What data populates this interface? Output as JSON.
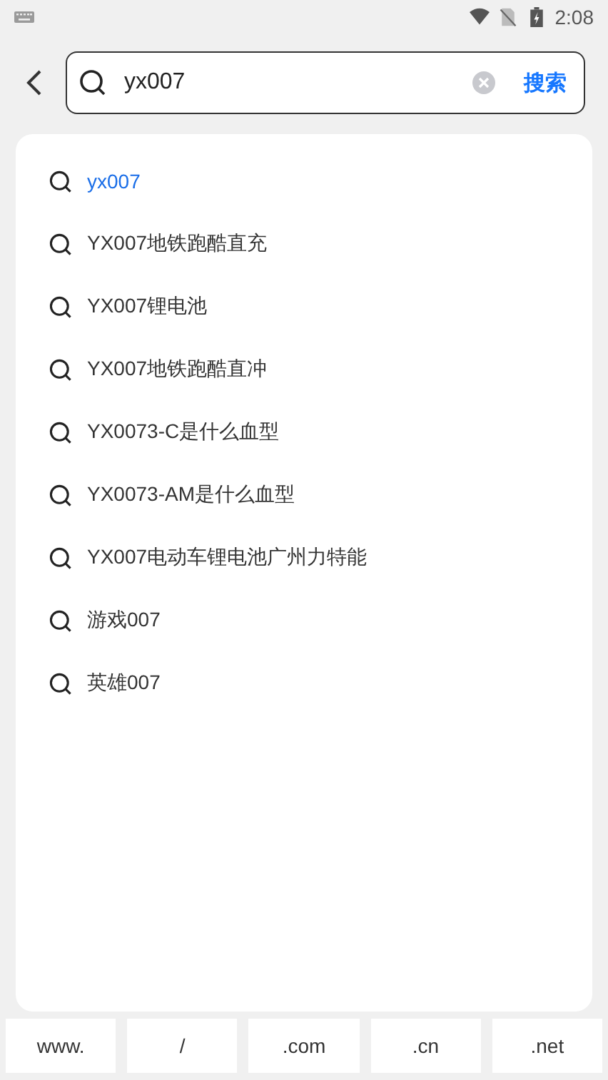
{
  "status_bar": {
    "time": "2:08"
  },
  "search": {
    "value": "yx007",
    "button": "搜索"
  },
  "suggestions": [
    {
      "text": "yx007",
      "highlighted": true
    },
    {
      "text": "YX007地铁跑酷直充",
      "highlighted": false
    },
    {
      "text": "YX007锂电池",
      "highlighted": false
    },
    {
      "text": "YX007地铁跑酷直冲",
      "highlighted": false
    },
    {
      "text": "YX0073-C是什么血型",
      "highlighted": false
    },
    {
      "text": "YX0073-AM是什么血型",
      "highlighted": false
    },
    {
      "text": "YX007电动车锂电池广州力特能",
      "highlighted": false
    },
    {
      "text": "游戏007",
      "highlighted": false
    },
    {
      "text": "英雄007",
      "highlighted": false
    }
  ],
  "quick_keys": [
    "www.",
    "/",
    ".com",
    ".cn",
    ".net"
  ]
}
